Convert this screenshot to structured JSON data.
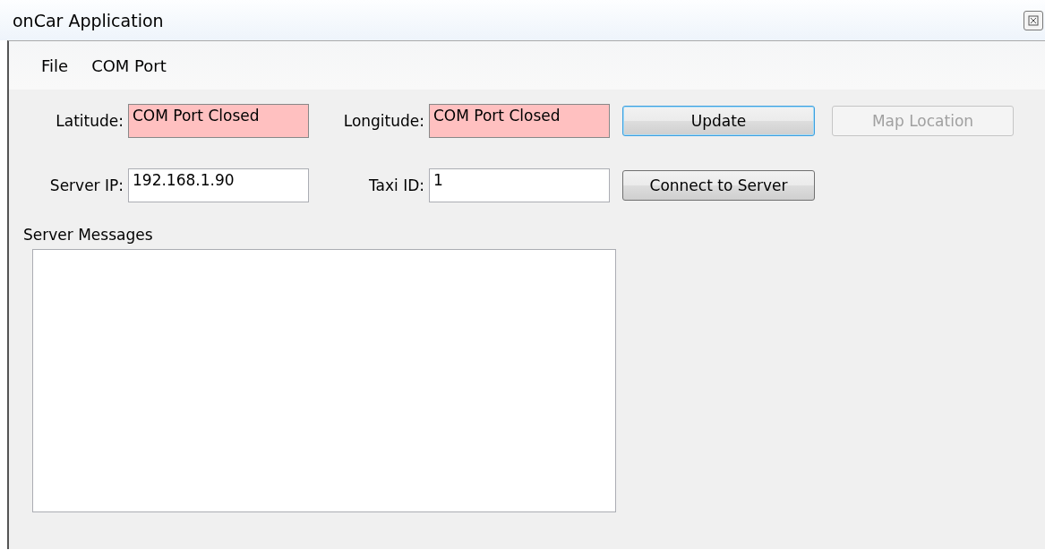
{
  "window": {
    "title": "onCar Application"
  },
  "menu": [
    "File",
    "COM Port"
  ],
  "rows": [
    {
      "fields": [
        {
          "label": "Latitude:",
          "value": "COM Port Closed",
          "alert": true
        },
        {
          "label": "Longitude:",
          "value": "COM Port Closed",
          "alert": true
        }
      ],
      "buttons": [
        {
          "label": "Update",
          "focused": true,
          "disabled": false
        },
        {
          "label": "Map Location",
          "focused": false,
          "disabled": true
        }
      ]
    },
    {
      "fields": [
        {
          "label": "Server IP:",
          "value": "192.168.1.90",
          "alert": false
        },
        {
          "label": "Taxi ID:",
          "value": "1",
          "alert": false
        }
      ],
      "buttons": [
        {
          "label": "Connect to Server",
          "focused": false,
          "disabled": false
        }
      ]
    }
  ],
  "messages": {
    "label": "Server Messages"
  }
}
